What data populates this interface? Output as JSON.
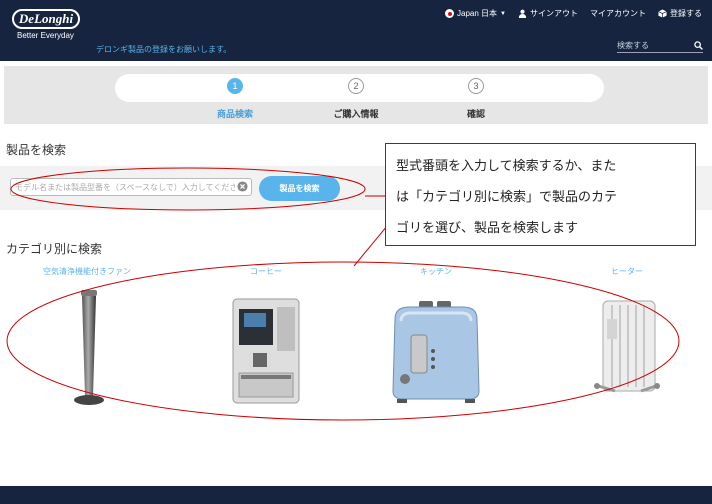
{
  "header": {
    "logo": "DeLonghi",
    "tagline": "Better Everyday",
    "subtitle": "デロンギ製品の登録をお願いします。",
    "nav": {
      "region": "Japan 日本",
      "signout": "サインアウト",
      "my_account": "マイアカウント",
      "register": "登録する"
    },
    "search_placeholder": "検索する"
  },
  "steps": [
    {
      "number": "1",
      "label": "商品検索",
      "active": true
    },
    {
      "number": "2",
      "label": "ご購入情報",
      "active": false
    },
    {
      "number": "3",
      "label": "確認",
      "active": false
    }
  ],
  "product_search": {
    "title": "製品を検索",
    "placeholder": "モデル名または製品型番を（スペースなしで）入力してください",
    "button": "製品を検索"
  },
  "category_search": {
    "title": "カテゴリ別に検索",
    "categories": [
      {
        "label": "空気清浄機能付きファン",
        "icon": "tower-fan-icon"
      },
      {
        "label": "コーヒー",
        "icon": "coffee-machine-icon"
      },
      {
        "label": "キッチン",
        "icon": "toaster-icon"
      },
      {
        "label": "ヒーター",
        "icon": "oil-heater-icon"
      }
    ]
  },
  "callout": {
    "lines": [
      "型式番頭を入力して検索するか、また",
      "は「カテゴリ別に検索」で製品のカテ",
      "ゴリを選び、製品を検索します"
    ]
  },
  "colors": {
    "header_bg": "#16243f",
    "accent": "#5ab4ec",
    "annotation": "#cc0000"
  }
}
